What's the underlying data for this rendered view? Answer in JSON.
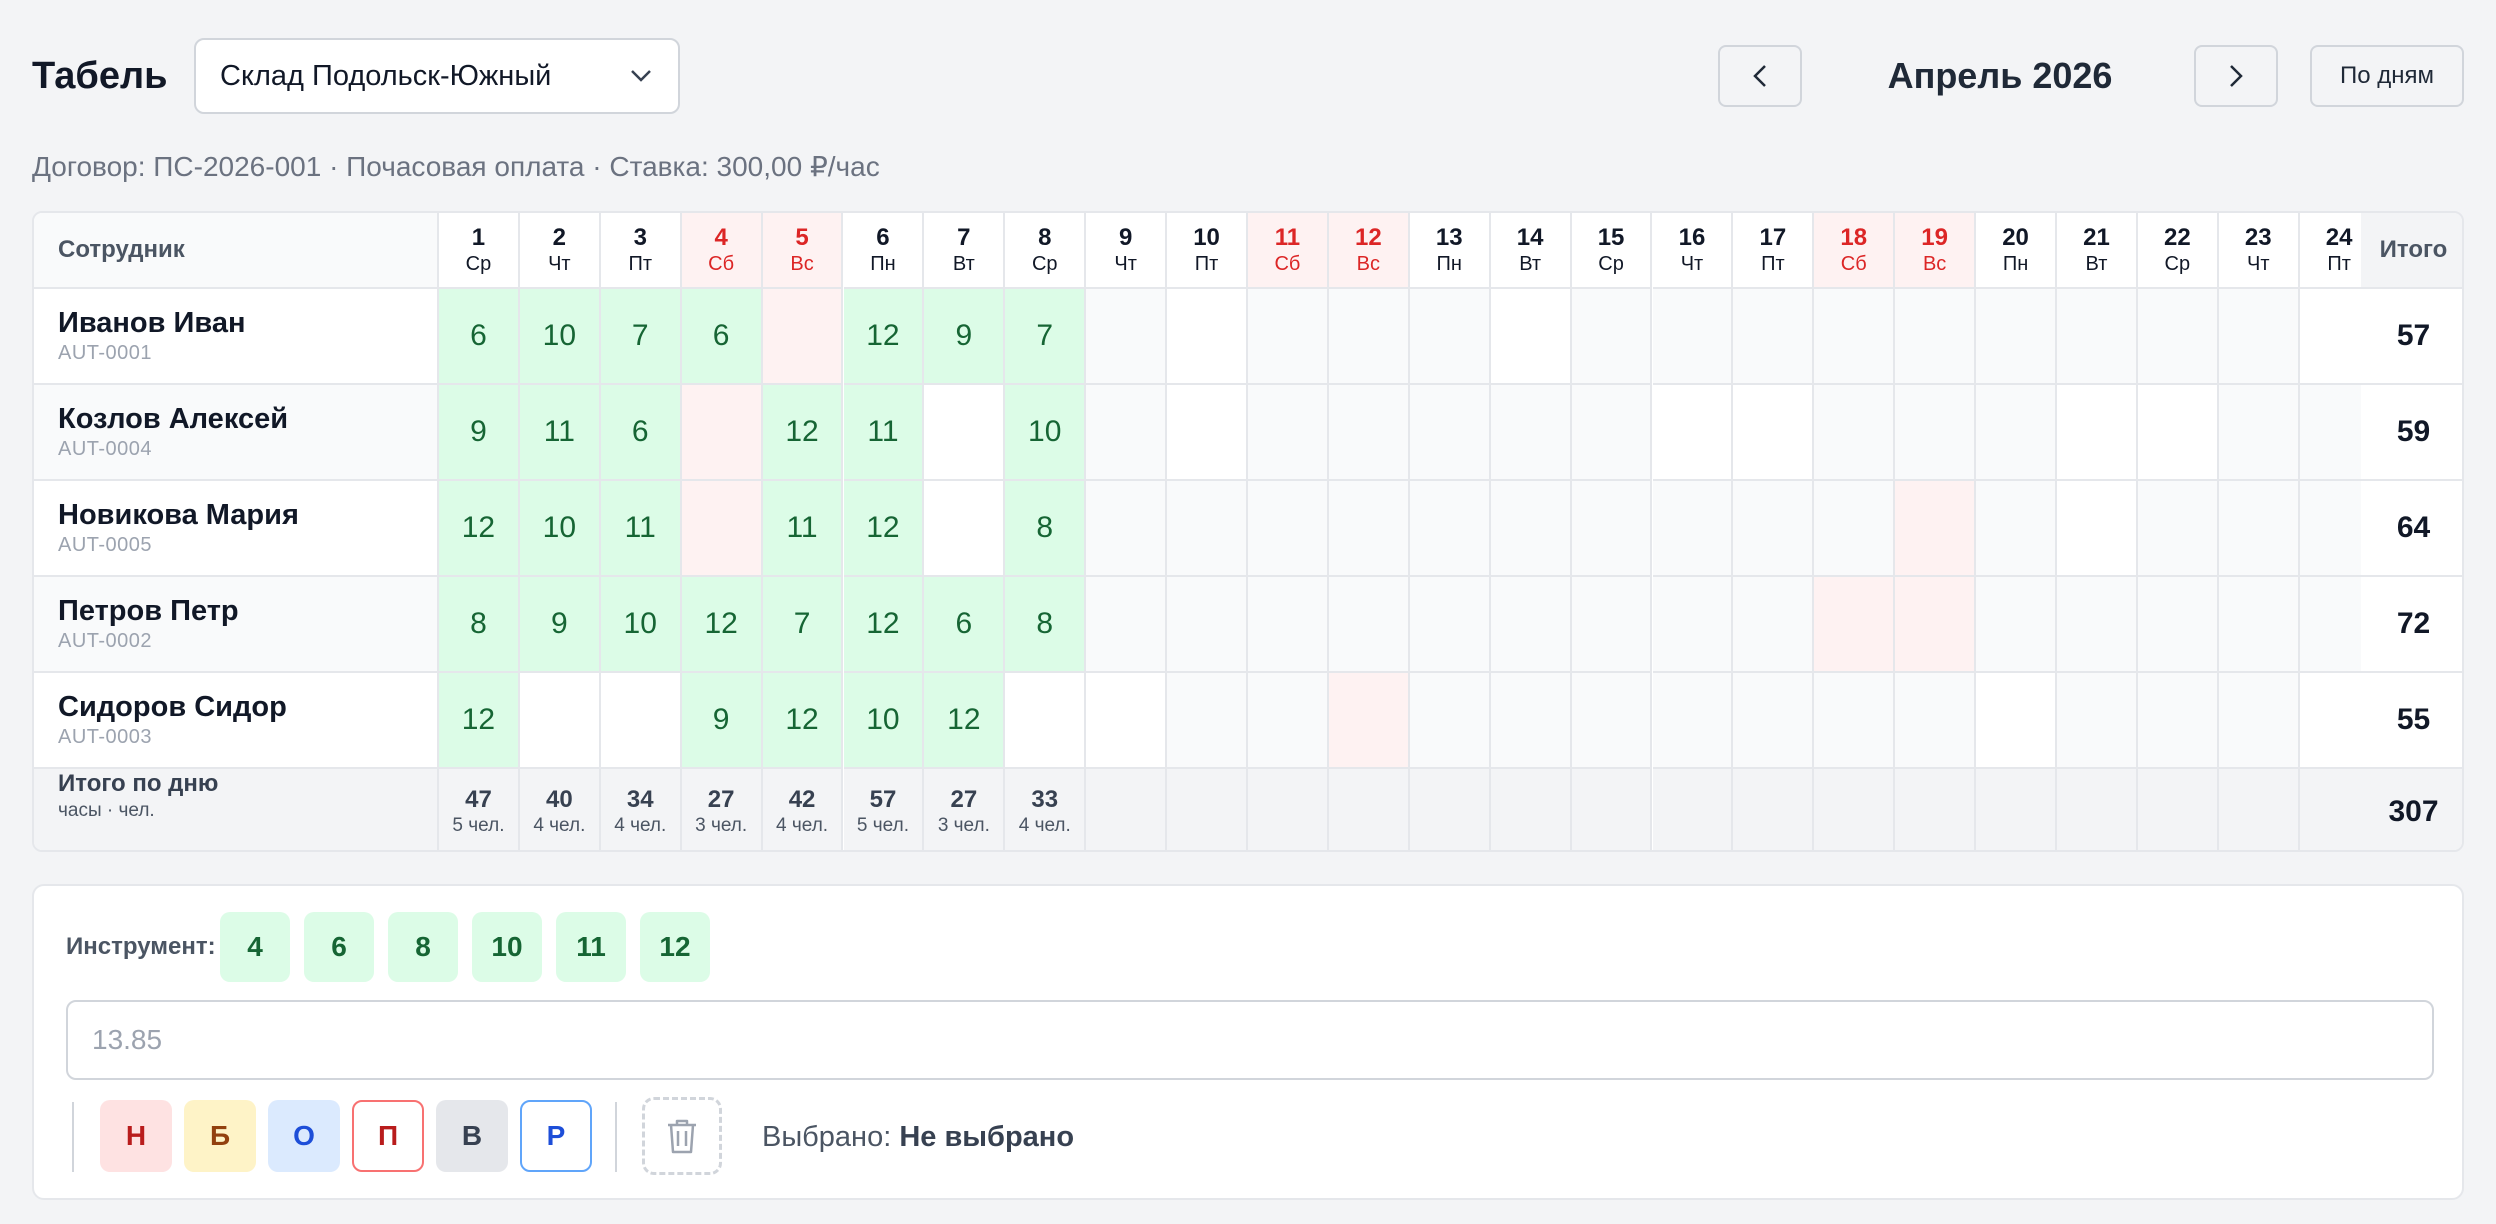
{
  "header": {
    "title": "Табель",
    "store": "Склад Подольск-Южный",
    "month": "Апрель 2026",
    "mode_button": "По дням",
    "contract_info": "Договор: ПС-2026-001 · Почасовая оплата · Ставка: 300,00 ₽/час"
  },
  "grid": {
    "employee_header": "Сотрудник",
    "total_header": "Итого",
    "days": [
      {
        "num": "1",
        "dow": "Ср",
        "weekend": false
      },
      {
        "num": "2",
        "dow": "Чт",
        "weekend": false
      },
      {
        "num": "3",
        "dow": "Пт",
        "weekend": false
      },
      {
        "num": "4",
        "dow": "Сб",
        "weekend": true
      },
      {
        "num": "5",
        "dow": "Вс",
        "weekend": true
      },
      {
        "num": "6",
        "dow": "Пн",
        "weekend": false
      },
      {
        "num": "7",
        "dow": "Вт",
        "weekend": false
      },
      {
        "num": "8",
        "dow": "Ср",
        "weekend": false
      },
      {
        "num": "9",
        "dow": "Чт",
        "weekend": false
      },
      {
        "num": "10",
        "dow": "Пт",
        "weekend": false
      },
      {
        "num": "11",
        "dow": "Сб",
        "weekend": true
      },
      {
        "num": "12",
        "dow": "Вс",
        "weekend": true
      },
      {
        "num": "13",
        "dow": "Пн",
        "weekend": false
      },
      {
        "num": "14",
        "dow": "Вт",
        "weekend": false
      },
      {
        "num": "15",
        "dow": "Ср",
        "weekend": false
      },
      {
        "num": "16",
        "dow": "Чт",
        "weekend": false
      },
      {
        "num": "17",
        "dow": "Пт",
        "weekend": false
      },
      {
        "num": "18",
        "dow": "Сб",
        "weekend": true
      },
      {
        "num": "19",
        "dow": "Вс",
        "weekend": true
      },
      {
        "num": "20",
        "dow": "Пн",
        "weekend": false
      },
      {
        "num": "21",
        "dow": "Вт",
        "weekend": false
      },
      {
        "num": "22",
        "dow": "Ср",
        "weekend": false
      },
      {
        "num": "23",
        "dow": "Чт",
        "weekend": false
      },
      {
        "num": "24",
        "dow": "Пт",
        "weekend": false
      }
    ],
    "employees": [
      {
        "name": "Иванов Иван",
        "code": "AUT-0001",
        "total": "57",
        "hours": [
          "6",
          "10",
          "7",
          "6",
          "",
          "12",
          "9",
          "7",
          "",
          "",
          "",
          "",
          "",
          "",
          "",
          "",
          "",
          "",
          "",
          "",
          "",
          "",
          "",
          ""
        ],
        "rest": [
          4
        ],
        "blank": [
          9,
          13,
          23
        ]
      },
      {
        "name": "Козлов Алексей",
        "code": "AUT-0004",
        "total": "59",
        "hours": [
          "9",
          "11",
          "6",
          "",
          "12",
          "11",
          "",
          "10",
          "",
          "",
          "",
          "",
          "",
          "",
          "",
          "",
          "",
          "",
          "",
          "",
          "",
          "",
          "",
          ""
        ],
        "rest": [
          3
        ],
        "blank": [
          6,
          9,
          15,
          16,
          20,
          21
        ]
      },
      {
        "name": "Новикова Мария",
        "code": "AUT-0005",
        "total": "64",
        "hours": [
          "12",
          "10",
          "11",
          "",
          "11",
          "12",
          "",
          "8",
          "",
          "",
          "",
          "",
          "",
          "",
          "",
          "",
          "",
          "",
          "",
          "",
          "",
          "",
          "",
          ""
        ],
        "rest": [
          3,
          18
        ],
        "blank": [
          6,
          20
        ]
      },
      {
        "name": "Петров Петр",
        "code": "AUT-0002",
        "total": "72",
        "hours": [
          "8",
          "9",
          "10",
          "12",
          "7",
          "12",
          "6",
          "8",
          "",
          "",
          "",
          "",
          "",
          "",
          "",
          "",
          "",
          "",
          "",
          "",
          "",
          "",
          "",
          ""
        ],
        "rest": [
          17,
          18
        ],
        "blank": []
      },
      {
        "name": "Сидоров Сидор",
        "code": "AUT-0003",
        "total": "55",
        "hours": [
          "12",
          "",
          "",
          "9",
          "12",
          "10",
          "12",
          "",
          "",
          "",
          "",
          "",
          "",
          "",
          "",
          "",
          "",
          "",
          "",
          "",
          "",
          "",
          "",
          ""
        ],
        "rest": [
          11
        ],
        "blank": [
          1,
          2,
          7,
          8,
          19,
          23
        ]
      }
    ],
    "footer": {
      "label": "Итого по дню",
      "sublabel": "часы · чел.",
      "sums": [
        "47",
        "40",
        "34",
        "27",
        "42",
        "57",
        "27",
        "33"
      ],
      "people": [
        "5 чел.",
        "4 чел.",
        "4 чел.",
        "3 чел.",
        "4 чел.",
        "5 чел.",
        "3 чел.",
        "4 чел."
      ],
      "grand_total": "307"
    }
  },
  "tool": {
    "label": "Инструмент:",
    "quick_hours": [
      "4",
      "6",
      "8",
      "10",
      "11",
      "12"
    ],
    "input_placeholder": "13.85",
    "codes": [
      {
        "label": "Н",
        "bg": "#fee2e2",
        "color": "#b91c1c",
        "border": "none"
      },
      {
        "label": "Б",
        "bg": "#fef3c7",
        "color": "#92400e",
        "border": "none"
      },
      {
        "label": "О",
        "bg": "#dbeafe",
        "color": "#1d4ed8",
        "border": "none"
      },
      {
        "label": "П",
        "bg": "#ffffff",
        "color": "#b91c1c",
        "border": "#f87171"
      },
      {
        "label": "В",
        "bg": "#e5e7eb",
        "color": "#374151",
        "border": "none"
      },
      {
        "label": "Р",
        "bg": "#ffffff",
        "color": "#1d4ed8",
        "border": "#60a5fa"
      }
    ],
    "selected_prefix": "Выбрано:",
    "selected_value": "Не выбрано"
  }
}
